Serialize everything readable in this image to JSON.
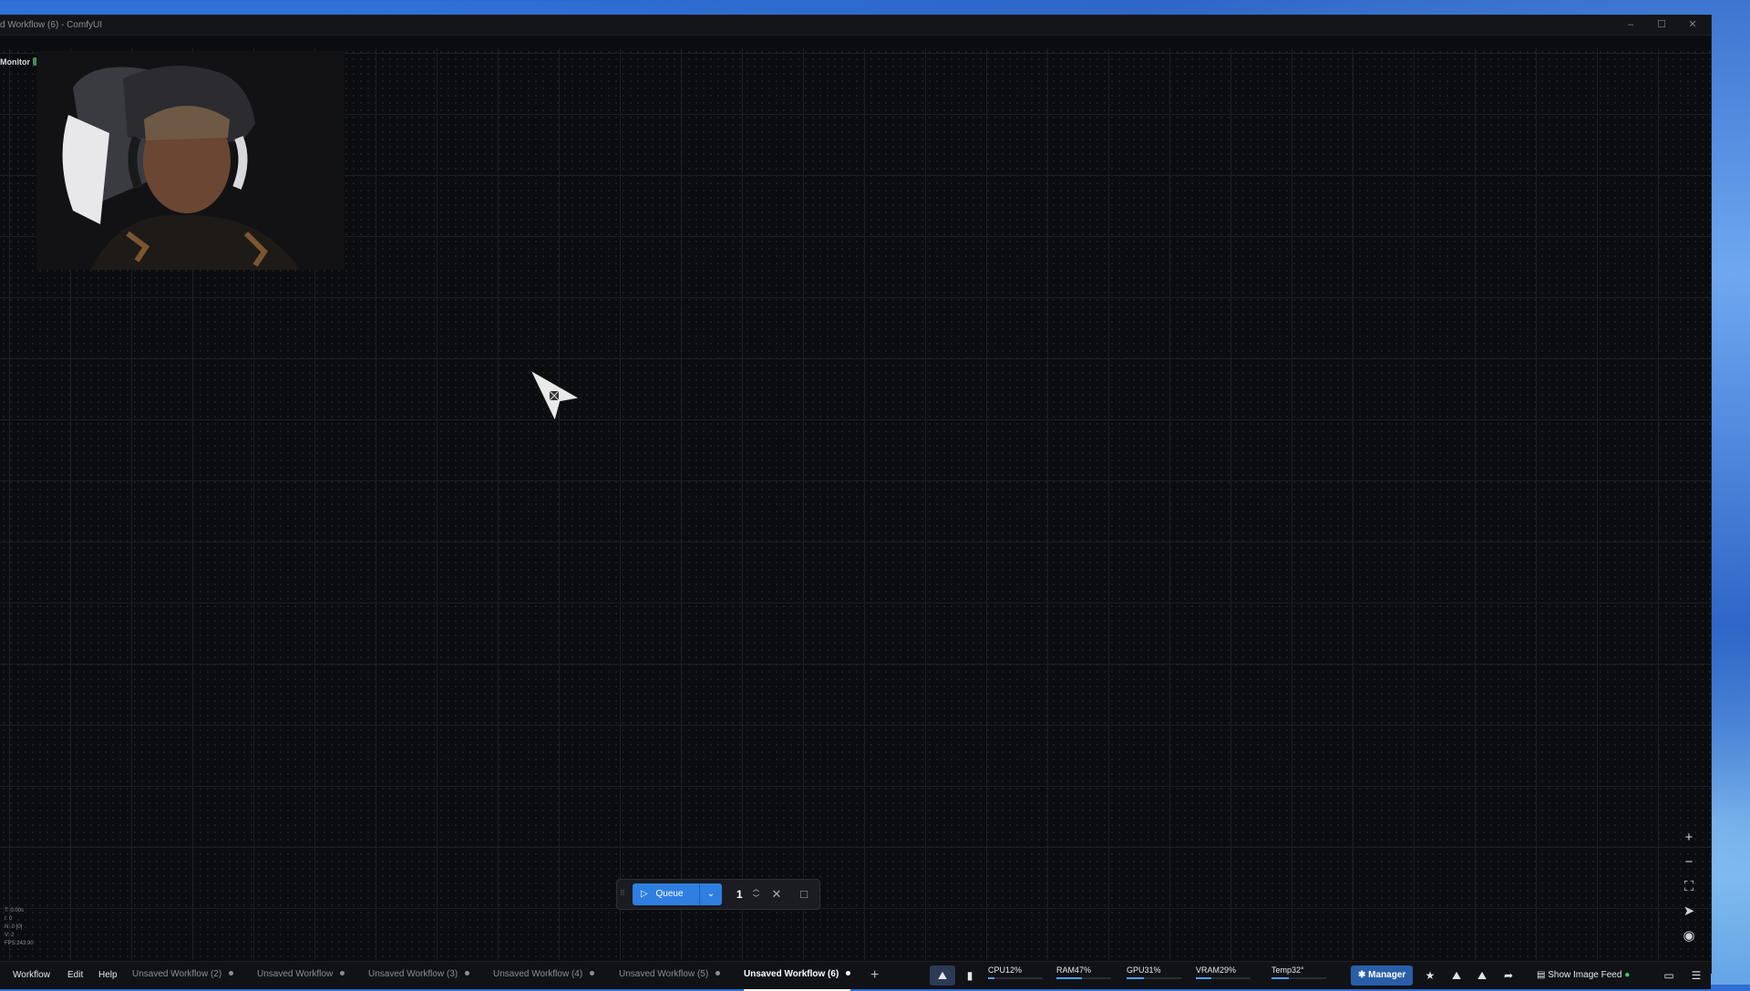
{
  "window": {
    "title": "d Workflow (6) - ComfyUI",
    "controls": {
      "minimize": "–",
      "maximize": "☐",
      "close": "✕"
    }
  },
  "overlay": {
    "monitor_label": "Monitor",
    "stats": [
      "T: 0.00s",
      "I: 0",
      "N: 0 [0]",
      "V: 2",
      "FPS:243.90"
    ]
  },
  "queue": {
    "label": "Queue",
    "count": "1",
    "icons": {
      "play": "▷",
      "dropdown": "⌄",
      "up": "︿",
      "down": "﹀",
      "cancel": "✕",
      "stop": "□"
    }
  },
  "canvas_controls": [
    "zoom-in",
    "zoom-out",
    "fit-view",
    "toggle-link",
    "visibility"
  ],
  "menu": [
    "Workflow",
    "Edit",
    "Help"
  ],
  "tabs": [
    {
      "label": "Unsaved Workflow (2)",
      "active": false
    },
    {
      "label": "Unsaved Workflow",
      "active": false
    },
    {
      "label": "Unsaved Workflow (3)",
      "active": false
    },
    {
      "label": "Unsaved Workflow (4)",
      "active": false
    },
    {
      "label": "Unsaved Workflow (5)",
      "active": false
    },
    {
      "label": "Unsaved Workflow (6)",
      "active": true
    }
  ],
  "metrics": {
    "cpu": "CPU12%",
    "cpu_pct": 12,
    "ram": "RAM47%",
    "ram_pct": 47,
    "gpu": "GPU31%",
    "gpu_pct": 31,
    "vram": "VRAM29%",
    "vram_pct": 29,
    "temp": "Temp32°",
    "temp_pct": 32
  },
  "right_toolbar": {
    "manager_label": "Manager",
    "show_image_feed": "Show Image Feed"
  },
  "colors": {
    "accent": "#2f7fe0",
    "manager": "#2a5ea8",
    "canvas": "#0b0c0f",
    "status_green": "#3fcf6d"
  }
}
